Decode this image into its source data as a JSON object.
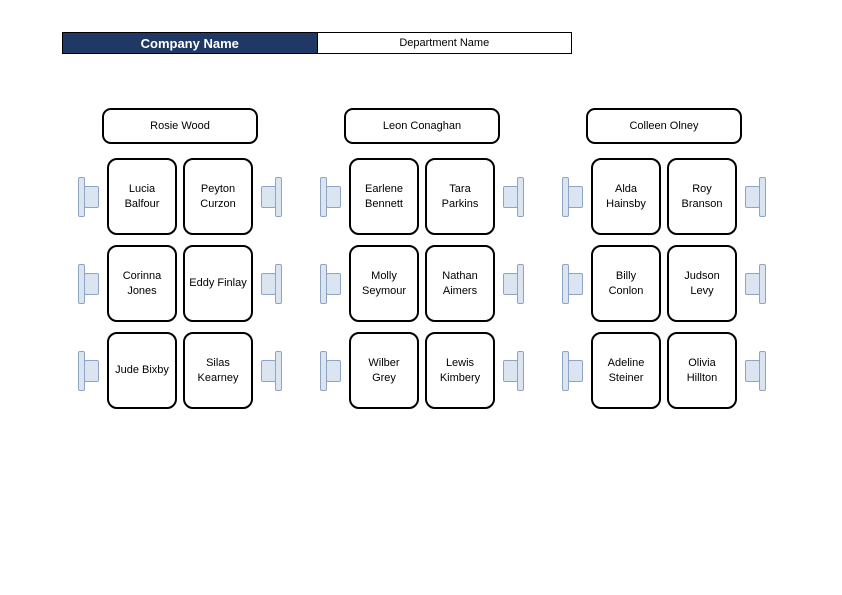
{
  "header": {
    "company": "Company Name",
    "department": "Department Name"
  },
  "clusters": [
    {
      "head": "Rosie Wood",
      "rows": [
        {
          "left": "Lucia Balfour",
          "right": "Peyton Curzon"
        },
        {
          "left": "Corinna Jones",
          "right": "Eddy Finlay"
        },
        {
          "left": "Jude Bixby",
          "right": "Silas Kearney"
        }
      ]
    },
    {
      "head": "Leon Conaghan",
      "rows": [
        {
          "left": "Earlene Bennett",
          "right": "Tara Parkins"
        },
        {
          "left": "Molly Seymour",
          "right": "Nathan Aimers"
        },
        {
          "left": "Wilber Grey",
          "right": "Lewis Kimbery"
        }
      ]
    },
    {
      "head": "Colleen Olney",
      "rows": [
        {
          "left": "Alda Hainsby",
          "right": "Roy Branson"
        },
        {
          "left": "Billy Conlon",
          "right": "Judson Levy"
        },
        {
          "left": "Adeline Steiner",
          "right": "Olivia Hillton"
        }
      ]
    }
  ]
}
